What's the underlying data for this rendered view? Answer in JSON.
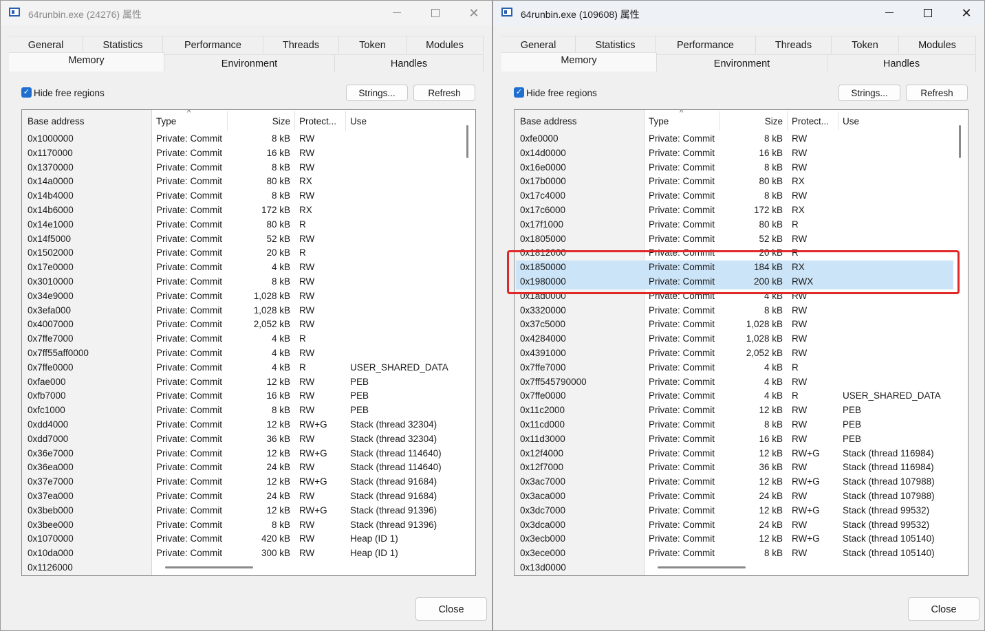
{
  "windows": [
    {
      "title": "64runbin.exe (24276) 属性",
      "tabs_row1": [
        "General",
        "Statistics",
        "Performance",
        "Threads",
        "Token",
        "Modules"
      ],
      "tabs_row2": [
        "Memory",
        "Environment",
        "Handles"
      ],
      "active_tab": "Memory",
      "hide_free_checked": true,
      "hide_free_label": "Hide free regions",
      "strings_label": "Strings...",
      "refresh_label": "Refresh",
      "close_label": "Close",
      "columns": [
        "Base address",
        "Type",
        "Size",
        "Protect...",
        "Use"
      ],
      "highlight_rows": [],
      "rows": [
        [
          "0x1000000",
          "Private: Commit",
          "8 kB",
          "RW",
          ""
        ],
        [
          "0x1170000",
          "Private: Commit",
          "16 kB",
          "RW",
          ""
        ],
        [
          "0x1370000",
          "Private: Commit",
          "8 kB",
          "RW",
          ""
        ],
        [
          "0x14a0000",
          "Private: Commit",
          "80 kB",
          "RX",
          ""
        ],
        [
          "0x14b4000",
          "Private: Commit",
          "8 kB",
          "RW",
          ""
        ],
        [
          "0x14b6000",
          "Private: Commit",
          "172 kB",
          "RX",
          ""
        ],
        [
          "0x14e1000",
          "Private: Commit",
          "80 kB",
          "R",
          ""
        ],
        [
          "0x14f5000",
          "Private: Commit",
          "52 kB",
          "RW",
          ""
        ],
        [
          "0x1502000",
          "Private: Commit",
          "20 kB",
          "R",
          ""
        ],
        [
          "0x17e0000",
          "Private: Commit",
          "4 kB",
          "RW",
          ""
        ],
        [
          "0x3010000",
          "Private: Commit",
          "8 kB",
          "RW",
          ""
        ],
        [
          "0x34e9000",
          "Private: Commit",
          "1,028 kB",
          "RW",
          ""
        ],
        [
          "0x3efa000",
          "Private: Commit",
          "1,028 kB",
          "RW",
          ""
        ],
        [
          "0x4007000",
          "Private: Commit",
          "2,052 kB",
          "RW",
          ""
        ],
        [
          "0x7ffe7000",
          "Private: Commit",
          "4 kB",
          "R",
          ""
        ],
        [
          "0x7ff55aff0000",
          "Private: Commit",
          "4 kB",
          "RW",
          ""
        ],
        [
          "0x7ffe0000",
          "Private: Commit",
          "4 kB",
          "R",
          "USER_SHARED_DATA"
        ],
        [
          "0xfae000",
          "Private: Commit",
          "12 kB",
          "RW",
          "PEB"
        ],
        [
          "0xfb7000",
          "Private: Commit",
          "16 kB",
          "RW",
          "PEB"
        ],
        [
          "0xfc1000",
          "Private: Commit",
          "8 kB",
          "RW",
          "PEB"
        ],
        [
          "0xdd4000",
          "Private: Commit",
          "12 kB",
          "RW+G",
          "Stack (thread 32304)"
        ],
        [
          "0xdd7000",
          "Private: Commit",
          "36 kB",
          "RW",
          "Stack (thread 32304)"
        ],
        [
          "0x36e7000",
          "Private: Commit",
          "12 kB",
          "RW+G",
          "Stack (thread 114640)"
        ],
        [
          "0x36ea000",
          "Private: Commit",
          "24 kB",
          "RW",
          "Stack (thread 114640)"
        ],
        [
          "0x37e7000",
          "Private: Commit",
          "12 kB",
          "RW+G",
          "Stack (thread 91684)"
        ],
        [
          "0x37ea000",
          "Private: Commit",
          "24 kB",
          "RW",
          "Stack (thread 91684)"
        ],
        [
          "0x3beb000",
          "Private: Commit",
          "12 kB",
          "RW+G",
          "Stack (thread 91396)"
        ],
        [
          "0x3bee000",
          "Private: Commit",
          "8 kB",
          "RW",
          "Stack (thread 91396)"
        ],
        [
          "0x1070000",
          "Private: Commit",
          "420 kB",
          "RW",
          "Heap (ID 1)"
        ],
        [
          "0x10da000",
          "Private: Commit",
          "300 kB",
          "RW",
          "Heap (ID 1)"
        ],
        [
          "0x1126000",
          "",
          "",
          "",
          ""
        ]
      ]
    },
    {
      "title": "64runbin.exe (109608) 属性",
      "tabs_row1": [
        "General",
        "Statistics",
        "Performance",
        "Threads",
        "Token",
        "Modules"
      ],
      "tabs_row2": [
        "Memory",
        "Environment",
        "Handles"
      ],
      "active_tab": "Memory",
      "hide_free_checked": true,
      "hide_free_label": "Hide free regions",
      "strings_label": "Strings...",
      "refresh_label": "Refresh",
      "close_label": "Close",
      "columns": [
        "Base address",
        "Type",
        "Size",
        "Protect...",
        "Use"
      ],
      "highlight_rows": [
        9,
        10
      ],
      "rows": [
        [
          "0xfe0000",
          "Private: Commit",
          "8 kB",
          "RW",
          ""
        ],
        [
          "0x14d0000",
          "Private: Commit",
          "16 kB",
          "RW",
          ""
        ],
        [
          "0x16e0000",
          "Private: Commit",
          "8 kB",
          "RW",
          ""
        ],
        [
          "0x17b0000",
          "Private: Commit",
          "80 kB",
          "RX",
          ""
        ],
        [
          "0x17c4000",
          "Private: Commit",
          "8 kB",
          "RW",
          ""
        ],
        [
          "0x17c6000",
          "Private: Commit",
          "172 kB",
          "RX",
          ""
        ],
        [
          "0x17f1000",
          "Private: Commit",
          "80 kB",
          "R",
          ""
        ],
        [
          "0x1805000",
          "Private: Commit",
          "52 kB",
          "RW",
          ""
        ],
        [
          "0x1812000",
          "Private: Commit",
          "20 kB",
          "R",
          ""
        ],
        [
          "0x1850000",
          "Private: Commit",
          "184 kB",
          "RX",
          ""
        ],
        [
          "0x1980000",
          "Private: Commit",
          "200 kB",
          "RWX",
          ""
        ],
        [
          "0x1ad0000",
          "Private: Commit",
          "4 kB",
          "RW",
          ""
        ],
        [
          "0x3320000",
          "Private: Commit",
          "8 kB",
          "RW",
          ""
        ],
        [
          "0x37c5000",
          "Private: Commit",
          "1,028 kB",
          "RW",
          ""
        ],
        [
          "0x4284000",
          "Private: Commit",
          "1,028 kB",
          "RW",
          ""
        ],
        [
          "0x4391000",
          "Private: Commit",
          "2,052 kB",
          "RW",
          ""
        ],
        [
          "0x7ffe7000",
          "Private: Commit",
          "4 kB",
          "R",
          ""
        ],
        [
          "0x7ff545790000",
          "Private: Commit",
          "4 kB",
          "RW",
          ""
        ],
        [
          "0x7ffe0000",
          "Private: Commit",
          "4 kB",
          "R",
          "USER_SHARED_DATA"
        ],
        [
          "0x11c2000",
          "Private: Commit",
          "12 kB",
          "RW",
          "PEB"
        ],
        [
          "0x11cd000",
          "Private: Commit",
          "8 kB",
          "RW",
          "PEB"
        ],
        [
          "0x11d3000",
          "Private: Commit",
          "16 kB",
          "RW",
          "PEB"
        ],
        [
          "0x12f4000",
          "Private: Commit",
          "12 kB",
          "RW+G",
          "Stack (thread 116984)"
        ],
        [
          "0x12f7000",
          "Private: Commit",
          "36 kB",
          "RW",
          "Stack (thread 116984)"
        ],
        [
          "0x3ac7000",
          "Private: Commit",
          "12 kB",
          "RW+G",
          "Stack (thread 107988)"
        ],
        [
          "0x3aca000",
          "Private: Commit",
          "24 kB",
          "RW",
          "Stack (thread 107988)"
        ],
        [
          "0x3dc7000",
          "Private: Commit",
          "12 kB",
          "RW+G",
          "Stack (thread 99532)"
        ],
        [
          "0x3dca000",
          "Private: Commit",
          "24 kB",
          "RW",
          "Stack (thread 99532)"
        ],
        [
          "0x3ecb000",
          "Private: Commit",
          "12 kB",
          "RW+G",
          "Stack (thread 105140)"
        ],
        [
          "0x3ece000",
          "Private: Commit",
          "8 kB",
          "RW",
          "Stack (thread 105140)"
        ],
        [
          "0x13d0000",
          "",
          "",
          "",
          ""
        ]
      ]
    }
  ]
}
